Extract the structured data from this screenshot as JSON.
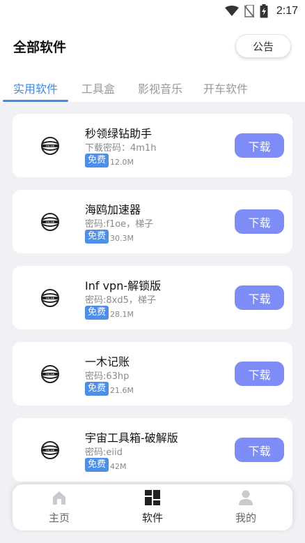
{
  "status_bar": {
    "time": "2:17",
    "icons": [
      "wifi-icon",
      "no-sim-icon",
      "battery-icon"
    ]
  },
  "header": {
    "title": "全部软件",
    "notice_label": "公告"
  },
  "tabs": [
    {
      "label": "实用软件",
      "active": true
    },
    {
      "label": "工具盒",
      "active": false
    },
    {
      "label": "影视音乐",
      "active": false
    },
    {
      "label": "开车软件",
      "active": false
    }
  ],
  "apps": [
    {
      "name": "秒领绿钻助手",
      "desc": "下载密码：4m1h",
      "badge": "免费",
      "size": "12.0M",
      "button": "下载"
    },
    {
      "name": "海鸥加速器",
      "desc": "密码:f1oe，梯子",
      "badge": "免费",
      "size": "30.3M",
      "button": "下载"
    },
    {
      "name": "Inf vpn-解锁版",
      "desc": "密码:8xd5，梯子",
      "badge": "免费",
      "size": "28.1M",
      "button": "下载"
    },
    {
      "name": "一木记账",
      "desc": "密码:63hp",
      "badge": "免费",
      "size": "21.6M",
      "button": "下载"
    },
    {
      "name": "宇宙工具箱-破解版",
      "desc": "密码:eiid",
      "badge": "免费",
      "size": "42M",
      "button": "下载"
    }
  ],
  "bottom_nav": [
    {
      "label": "主页",
      "icon": "home-icon",
      "active": false
    },
    {
      "label": "软件",
      "icon": "grid-icon",
      "active": true
    },
    {
      "label": "我的",
      "icon": "user-icon",
      "active": false
    }
  ],
  "colors": {
    "accent_blue": "#3b8be8",
    "download_button": "#7d8cf7",
    "free_badge": "#4d8fe8",
    "content_bg": "#f1f1f5"
  }
}
